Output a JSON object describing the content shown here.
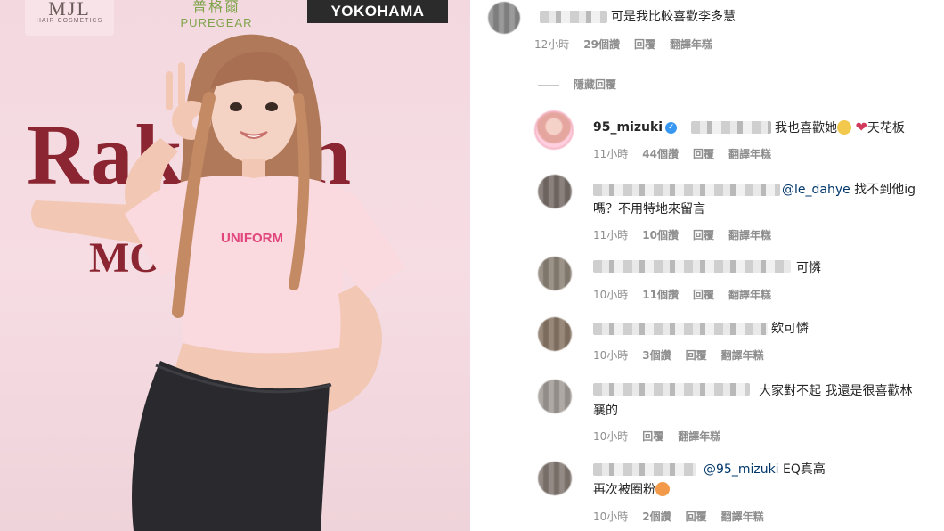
{
  "photo": {
    "logos": {
      "mjl": "MJL",
      "mjl_sub": "HAIR COSMETICS",
      "pure_cn": "普格爾",
      "pure_en": "PUREGEAR",
      "yokohama": "YOKOHAMA"
    },
    "backdrop_text_1": "Rakuten",
    "backdrop_text_2": "MO",
    "shirt_text": "UNIFORM"
  },
  "comments": [
    {
      "id": "c1",
      "text": "可是我比較喜歡李多慧",
      "time": "12小時",
      "likes": "29個讚",
      "reply": "回覆",
      "translate": "翻譯年糕"
    },
    {
      "id": "hide",
      "text": "隱藏回覆"
    },
    {
      "id": "c2",
      "username": "95_mizuki",
      "text": "我也喜歡她",
      "text_tail": "天花板",
      "time": "11小時",
      "likes": "44個讚",
      "reply": "回覆",
      "translate": "翻譯年糕"
    },
    {
      "id": "c3",
      "mention": "@le_dahye",
      "text": "找不到他ig",
      "text_line2": "嗎？不用特地來留言",
      "time": "11小時",
      "likes": "10個讚",
      "reply": "回覆",
      "translate": "翻譯年糕"
    },
    {
      "id": "c4",
      "text": "可憐",
      "time": "10小時",
      "likes": "11個讚",
      "reply": "回覆",
      "translate": "翻譯年糕"
    },
    {
      "id": "c5",
      "text": "欸可憐",
      "time": "10小時",
      "likes": "3個讚",
      "reply": "回覆",
      "translate": "翻譯年糕"
    },
    {
      "id": "c6",
      "text": "大家對不起 我還是很喜歡林",
      "text_line2": "襄的",
      "time": "10小時",
      "reply": "回覆",
      "translate": "翻譯年糕"
    },
    {
      "id": "c7",
      "mention": "@95_mizuki",
      "text": "EQ真高",
      "text_line2": "再次被圈粉",
      "time": "10小時",
      "likes": "2個讚",
      "reply": "回覆",
      "translate": "翻譯年糕"
    }
  ]
}
